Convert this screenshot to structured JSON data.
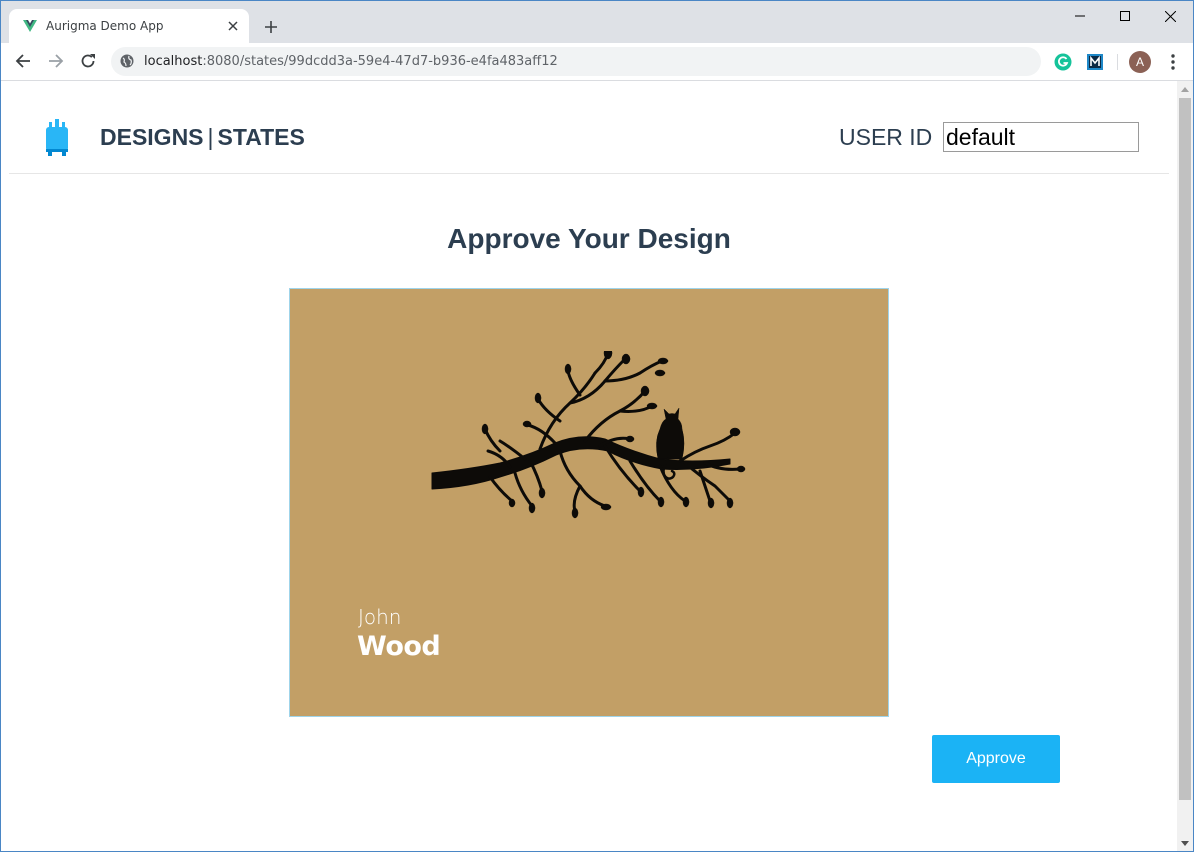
{
  "browser": {
    "tab": {
      "title": "Aurigma Demo App",
      "favicon": "vue-logo-icon"
    },
    "url": {
      "host": "localhost",
      "path": ":8080/states/99dcdd3a-59e4-47d7-b936-e4fa483aff12"
    },
    "extensions": [
      "grammarly-icon",
      "m-extension-icon"
    ],
    "profile_initial": "A"
  },
  "header": {
    "logo": "paint-tube-icon",
    "nav": {
      "designs": "DESIGNS",
      "separator": "|",
      "states": "STATES"
    },
    "user_id_label": "USER ID",
    "user_id_value": "default"
  },
  "main": {
    "heading": "Approve Your Design",
    "design": {
      "first_name": "John",
      "last_name": "Wood",
      "background_color": "#c29f66",
      "artwork": "cat-on-branch-silhouette"
    },
    "approve_label": "Approve"
  },
  "colors": {
    "accent": "#1bb3f5",
    "heading": "#2c3e50"
  }
}
